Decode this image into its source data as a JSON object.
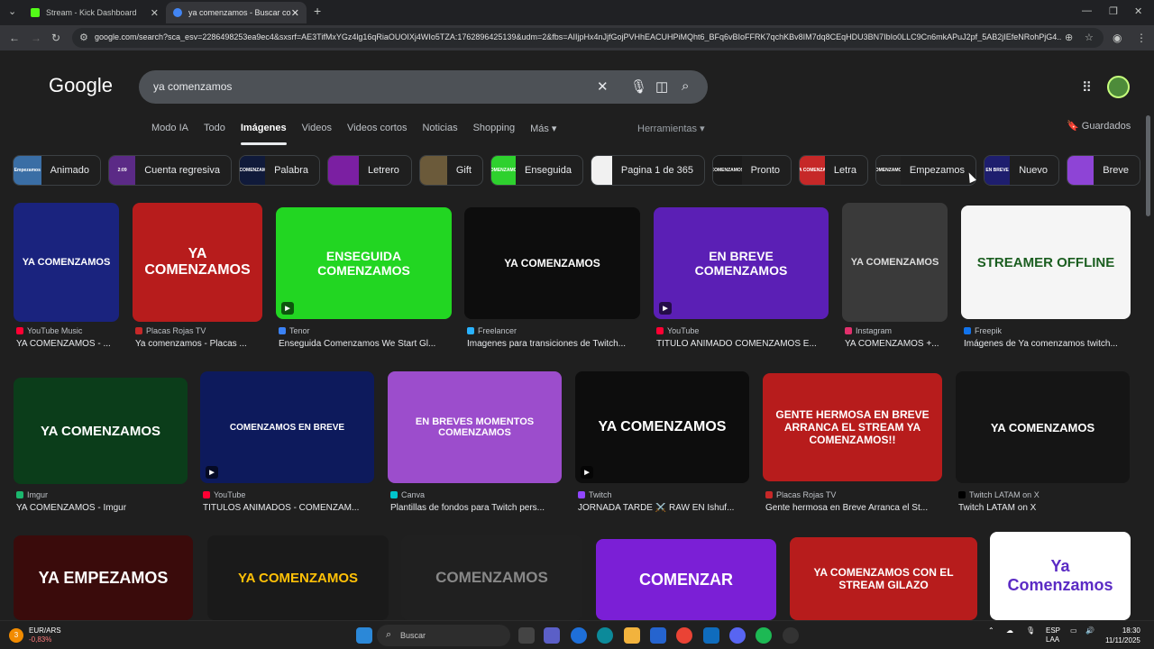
{
  "browser": {
    "tabs": [
      {
        "label": "Stream - Kick Dashboard",
        "favicon_color": "#53fc18"
      },
      {
        "label": "ya comenzamos - Buscar con G",
        "favicon_color": "#4285f4"
      }
    ],
    "url": "google.com/search?sca_esv=2286498253ea9ec4&sxsrf=AE3TifMxYGz4lg16qRiaOUOIXj4WIo5TZA:1762896425139&udm=2&fbs=AIIjpHx4nJjfGojPVHhEACUHPiMQht6_BFq6vBIoFFRK7qchKBv8IM7dq8CEqHDU3BN7IbIo0LLC9Cn6mkAPuJ2pf_5AB2jIEfeNRohPjG4..."
  },
  "google": {
    "logo": "Google",
    "query": "ya comenzamos",
    "tabs": [
      "Modo IA",
      "Todo",
      "Imágenes",
      "Videos",
      "Videos cortos",
      "Noticias",
      "Shopping",
      "Más ▾"
    ],
    "tools": "Herramientas ▾",
    "saved": "Guardados"
  },
  "chips": [
    {
      "label": "Animado",
      "thumb": "Empezamos",
      "color": "#3a6ea5"
    },
    {
      "label": "Cuenta regresiva",
      "thumb": "2:09",
      "color": "#5b2a86"
    },
    {
      "label": "Palabra",
      "thumb": "YA COMENZAMOS",
      "color": "#101a3a"
    },
    {
      "label": "Letrero",
      "thumb": "",
      "color": "#7b1fa2"
    },
    {
      "label": "Gift",
      "thumb": "",
      "color": "#6b5a3a"
    },
    {
      "label": "Enseguida",
      "thumb": "COMENZAMOS",
      "color": "#2ed12e"
    },
    {
      "label": "Pagina 1 de 365",
      "thumb": "",
      "color": "#f1f1f1"
    },
    {
      "label": "Pronto",
      "thumb": "COMENZAMOS",
      "color": "#1a1a1a"
    },
    {
      "label": "Letra",
      "thumb": "A COMENZA",
      "color": "#c62828"
    },
    {
      "label": "Empezamos",
      "thumb": "COMENZAMOS",
      "color": "#222222"
    },
    {
      "label": "Nuevo",
      "thumb": "EN BREVE",
      "color": "#1e1e6e"
    },
    {
      "label": "Breve",
      "thumb": "",
      "color": "#8e44d6"
    }
  ],
  "results": [
    {
      "source": "YouTube Music",
      "title": "YA COMENZAMOS - ...",
      "thumb": "YA COMENZAMOS",
      "icon_color": "#ff0033"
    },
    {
      "source": "Placas Rojas TV",
      "title": "Ya comenzamos - Placas ...",
      "thumb": "YA COMENZAMOS",
      "icon_color": "#c62828"
    },
    {
      "source": "Tenor",
      "title": "Enseguida Comenzamos We Start Gl...",
      "thumb": "ENSEGUIDA COMENZAMOS",
      "icon_color": "#3b82f6"
    },
    {
      "source": "Freelancer",
      "title": "Imagenes para transiciones de Twitch...",
      "thumb": "YA COMENZAMOS",
      "icon_color": "#29b2fe"
    },
    {
      "source": "YouTube",
      "title": "TITULO ANIMADO COMENZAMOS E...",
      "thumb": "EN BREVE COMENZAMOS",
      "icon_color": "#ff0033"
    },
    {
      "source": "Instagram",
      "title": "YA COMENZAMOS +...",
      "thumb": "YA COMENZAMOS",
      "icon_color": "#e1306c"
    },
    {
      "source": "Freepik",
      "title": "Imágenes de Ya comenzamos twitch...",
      "thumb": "STREAMER OFFLINE",
      "icon_color": "#1273eb"
    },
    {
      "source": "Imgur",
      "title": "YA COMENZAMOS - Imgur",
      "thumb": "YA COMENZAMOS",
      "icon_color": "#1bb76e"
    },
    {
      "source": "YouTube",
      "title": "TITULOS ANIMADOS - COMENZAM...",
      "thumb": "COMENZAMOS EN BREVE",
      "icon_color": "#ff0033"
    },
    {
      "source": "Canva",
      "title": "Plantillas de fondos para Twitch pers...",
      "thumb": "EN BREVES MOMENTOS COMENZAMOS",
      "icon_color": "#00c4cc"
    },
    {
      "source": "Twitch",
      "title": "JORNADA TARDE ⚔️ RAW EN Ishuf...",
      "thumb": "YA COMENZAMOS",
      "icon_color": "#9146ff"
    },
    {
      "source": "Placas Rojas TV",
      "title": "Gente hermosa en Breve Arranca el St...",
      "thumb": "GENTE HERMOSA EN BREVE ARRANCA EL STREAM YA COMENZAMOS!!",
      "icon_color": "#c62828"
    },
    {
      "source": "Twitch LATAM on X",
      "title": "Twitch LATAM on X",
      "thumb": "YA COMENZAMOS",
      "icon_color": "#000000"
    },
    {
      "source": "",
      "title": "",
      "thumb": "YA EMPEZAMOS",
      "icon_color": ""
    },
    {
      "source": "",
      "title": "",
      "thumb": "YA COMENZAMOS",
      "icon_color": ""
    },
    {
      "source": "",
      "title": "",
      "thumb": "COMENZAMOS",
      "icon_color": ""
    },
    {
      "source": "",
      "title": "",
      "thumb": "COMENZAR",
      "icon_color": ""
    },
    {
      "source": "",
      "title": "",
      "thumb": "YA COMENZAMOS CON EL STREAM GILAZO",
      "icon_color": ""
    },
    {
      "source": "",
      "title": "",
      "thumb": "Ya Comenzamos",
      "icon_color": ""
    }
  ],
  "taskbar": {
    "weather_name": "EUR/ARS",
    "weather_value": "-0,83%",
    "badge": "3",
    "search": "Buscar",
    "lang1": "ESP",
    "lang2": "LAA",
    "time": "18:30",
    "date": "11/11/2025"
  }
}
